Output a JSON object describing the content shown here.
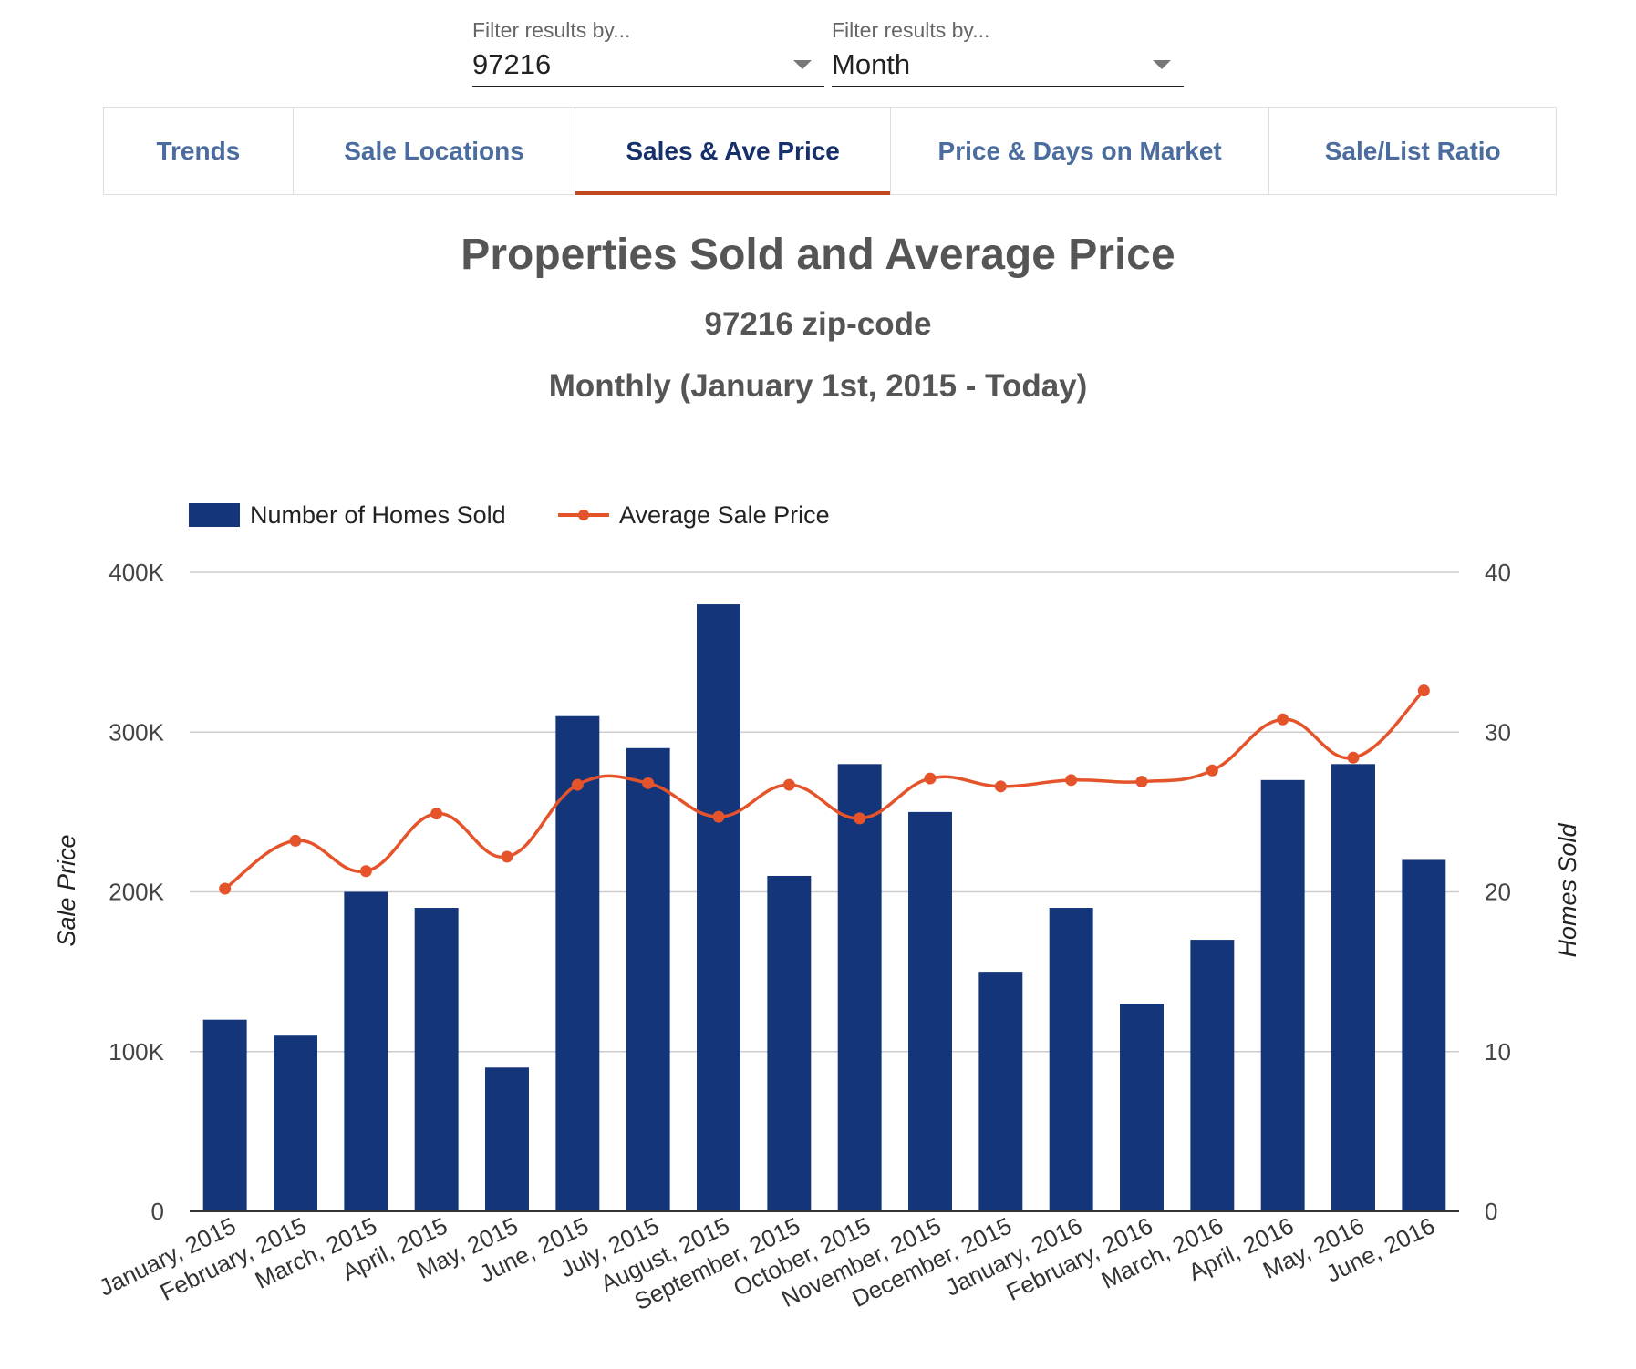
{
  "filters": [
    {
      "label": "Filter results by...",
      "value": "97216"
    },
    {
      "label": "Filter results by...",
      "value": "Month"
    }
  ],
  "tabs": [
    "Trends",
    "Sale Locations",
    "Sales & Ave Price",
    "Price & Days on Market",
    "Sale/List Ratio"
  ],
  "active_tab": "Sales & Ave Price",
  "colors": {
    "bar": "#15357a",
    "line": "#e5532b",
    "grid": "#cccccc",
    "axis": "#333333",
    "tab_accent": "#c1481f"
  },
  "chart_data": {
    "type": "bar",
    "title": "Properties Sold and Average Price",
    "subtitle": "97216 zip-code",
    "subtitle2": "Monthly (January 1st, 2015 - Today)",
    "categories": [
      "January, 2015",
      "February, 2015",
      "March, 2015",
      "April, 2015",
      "May, 2015",
      "June, 2015",
      "July, 2015",
      "August, 2015",
      "September, 2015",
      "October, 2015",
      "November, 2015",
      "December, 2015",
      "January, 2016",
      "February, 2016",
      "March, 2016",
      "April, 2016",
      "May, 2016",
      "June, 2016"
    ],
    "series": [
      {
        "name": "Number of Homes Sold",
        "type": "bar",
        "axis": "right",
        "values": [
          12,
          11,
          20,
          19,
          9,
          31,
          29,
          38,
          21,
          28,
          25,
          15,
          19,
          13,
          17,
          27,
          28,
          22
        ]
      },
      {
        "name": "Average Sale Price",
        "type": "line",
        "axis": "left",
        "values": [
          202000,
          232000,
          213000,
          249000,
          222000,
          267000,
          268000,
          247000,
          267000,
          246000,
          271000,
          266000,
          270000,
          269000,
          276000,
          308000,
          284000,
          326000
        ]
      }
    ],
    "ylabel_left": "Sale Price",
    "ylabel_right": "Homes Sold",
    "ylim_left": [
      0,
      400000
    ],
    "ylim_right": [
      0,
      40
    ],
    "yticks_left": [
      "0",
      "100K",
      "200K",
      "300K",
      "400K"
    ],
    "yticks_right": [
      "0",
      "10",
      "20",
      "30",
      "40"
    ],
    "legend_position": "top-left",
    "grid": true
  }
}
